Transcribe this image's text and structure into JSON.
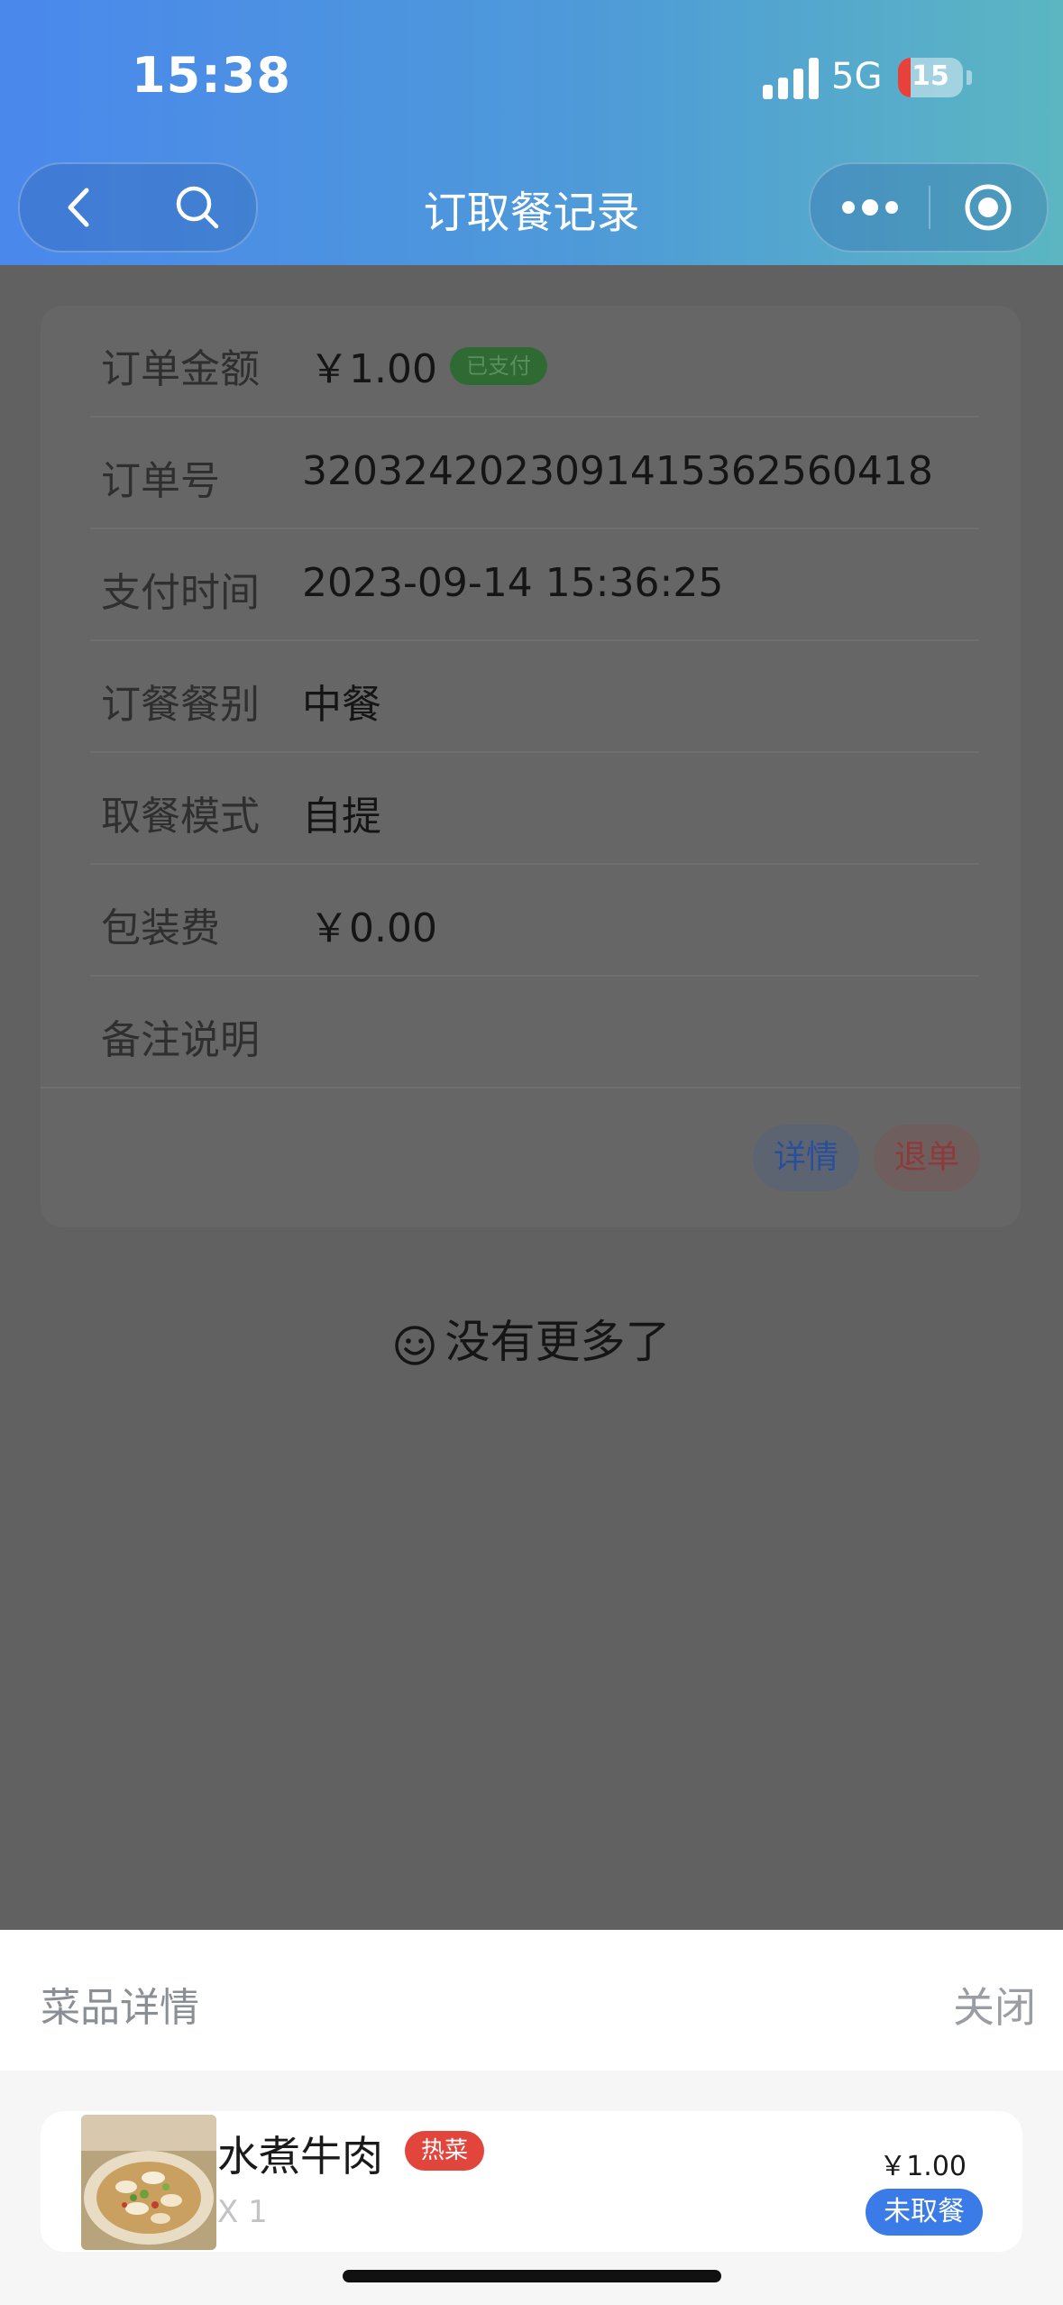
{
  "status_bar": {
    "time": "15:38",
    "network": "5G",
    "battery": "15"
  },
  "nav": {
    "title": "订取餐记录",
    "back_icon": "back-icon",
    "search_icon": "search-icon",
    "more_icon": "more-icon",
    "capsule_icon": "record-icon"
  },
  "order": {
    "rows": [
      {
        "label": "订单金额",
        "value": "￥1.00",
        "badge": "已支付"
      },
      {
        "label": "订单号",
        "value": "3203242023091415362560418"
      },
      {
        "label": "支付时间",
        "value": "2023-09-14 15:36:25"
      },
      {
        "label": "订餐餐别",
        "value": "中餐"
      },
      {
        "label": "取餐模式",
        "value": "自提"
      },
      {
        "label": "包装费",
        "value": "￥0.00"
      },
      {
        "label": "备注说明",
        "value": ""
      }
    ],
    "detail_button": "详情",
    "refund_button": "退单"
  },
  "no_more": "没有更多了",
  "sheet": {
    "title": "菜品详情",
    "close": "关闭",
    "dish": {
      "name": "水煮牛肉",
      "tag": "热菜",
      "quantity": "X 1",
      "price": "￥1.00",
      "status": "未取餐"
    }
  },
  "colors": {
    "header_start": "#4a88ec",
    "header_end": "#5bb6c2",
    "paid": "#2e6a31",
    "hot_tag": "#e1453b",
    "status": "#3a7be7"
  }
}
